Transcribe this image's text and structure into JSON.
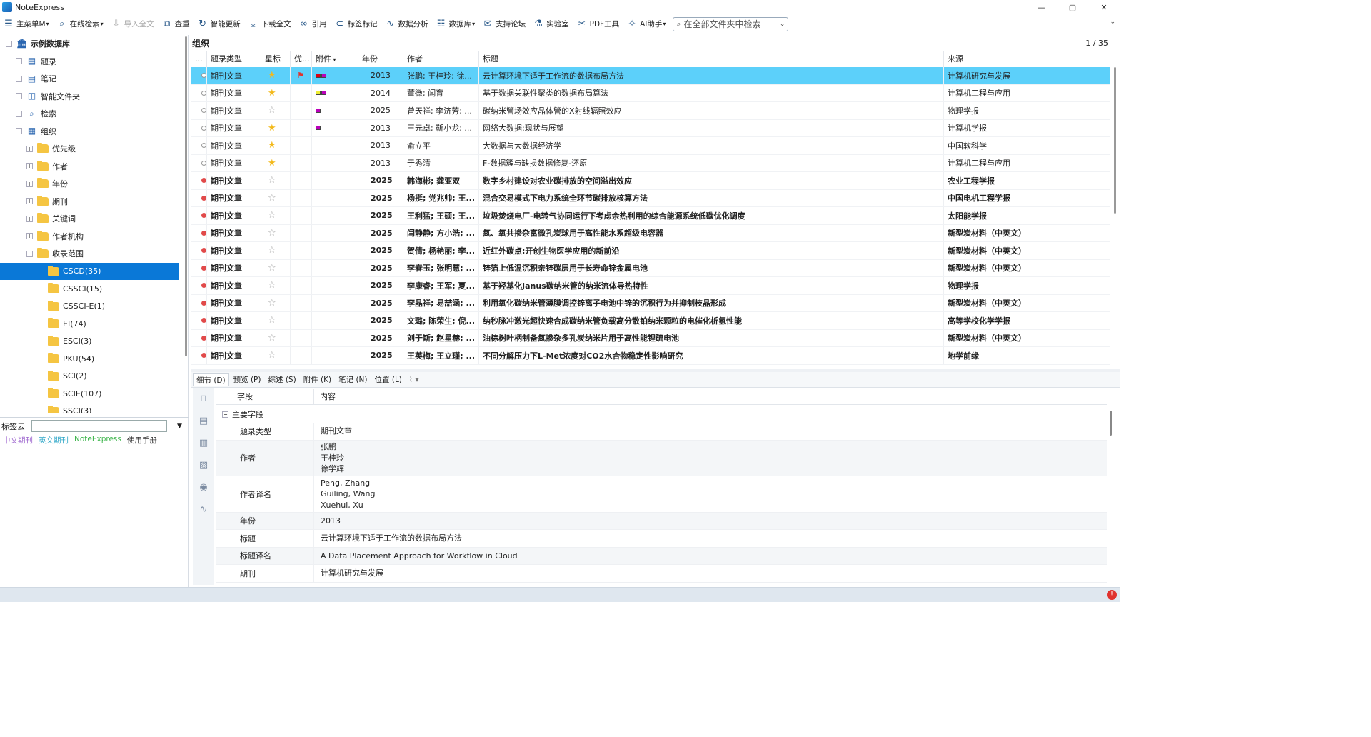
{
  "app": {
    "title": "NoteExpress",
    "min_label": "—",
    "max_label": "▢",
    "close_label": "✕"
  },
  "toolbar": [
    {
      "name": "main-menu",
      "label": "主菜单M",
      "icon": "menu-icon",
      "glyph": "☰",
      "dd": true,
      "enabled": true
    },
    {
      "name": "online-search",
      "label": "在线检索",
      "icon": "search-icon",
      "glyph": "⌕",
      "dd": true,
      "enabled": true
    },
    {
      "name": "import-fulltext",
      "label": "导入全文",
      "icon": "import-icon",
      "glyph": "⇩",
      "dd": false,
      "enabled": false
    },
    {
      "name": "dedupe",
      "label": "查重",
      "icon": "dedupe-icon",
      "glyph": "⧉",
      "dd": false,
      "enabled": true
    },
    {
      "name": "smart-update",
      "label": "智能更新",
      "icon": "refresh-icon",
      "glyph": "↻",
      "dd": false,
      "enabled": true
    },
    {
      "name": "download-fulltext",
      "label": "下载全文",
      "icon": "download-icon",
      "glyph": "⤓",
      "dd": false,
      "enabled": true
    },
    {
      "name": "cite",
      "label": "引用",
      "icon": "link-icon",
      "glyph": "∞",
      "dd": false,
      "enabled": true
    },
    {
      "name": "tag-mark",
      "label": "标签标记",
      "icon": "tag-icon",
      "glyph": "⊂",
      "dd": false,
      "enabled": true
    },
    {
      "name": "data-analysis",
      "label": "数据分析",
      "icon": "chart-icon",
      "glyph": "∿",
      "dd": false,
      "enabled": true
    },
    {
      "name": "database",
      "label": "数据库",
      "icon": "database-icon",
      "glyph": "☷",
      "dd": true,
      "enabled": true
    },
    {
      "name": "support-forum",
      "label": "支持论坛",
      "icon": "forum-icon",
      "glyph": "✉",
      "dd": false,
      "enabled": true
    },
    {
      "name": "lab",
      "label": "实验室",
      "icon": "flask-icon",
      "glyph": "⚗",
      "dd": false,
      "enabled": true
    },
    {
      "name": "pdf-tools",
      "label": "PDF工具",
      "icon": "tools-icon",
      "glyph": "✂",
      "dd": false,
      "enabled": true
    },
    {
      "name": "ai-assistant",
      "label": "AI助手",
      "icon": "ai-icon",
      "glyph": "✧",
      "dd": true,
      "enabled": true
    }
  ],
  "search": {
    "text": "在全部文件夹中检索",
    "more": "⌄"
  },
  "tree": {
    "root": "示例数据库",
    "items": [
      {
        "label": "题录",
        "level": 1,
        "icon": "records-icon",
        "glyph": "▤",
        "exp": "+"
      },
      {
        "label": "笔记",
        "level": 1,
        "icon": "notes-icon",
        "glyph": "▤",
        "exp": "+"
      },
      {
        "label": "智能文件夹",
        "level": 1,
        "icon": "smart-folder-icon",
        "glyph": "◫",
        "exp": "+"
      },
      {
        "label": "检索",
        "level": 1,
        "icon": "search-tree-icon",
        "glyph": "⌕",
        "exp": "+"
      },
      {
        "label": "组织",
        "level": 1,
        "icon": "organize-icon",
        "glyph": "▦",
        "exp": "−"
      },
      {
        "label": "优先级",
        "level": 2,
        "exp": "+"
      },
      {
        "label": "作者",
        "level": 2,
        "exp": "+"
      },
      {
        "label": "年份",
        "level": 2,
        "exp": "+"
      },
      {
        "label": "期刊",
        "level": 2,
        "exp": "+"
      },
      {
        "label": "关键词",
        "level": 2,
        "exp": "+"
      },
      {
        "label": "作者机构",
        "level": 2,
        "exp": "+"
      },
      {
        "label": "收录范围",
        "level": 2,
        "exp": "−"
      },
      {
        "label": "CSCD(35)",
        "level": 3,
        "sel": true
      },
      {
        "label": "CSSCI(15)",
        "level": 3
      },
      {
        "label": "CSSCI-E(1)",
        "level": 3
      },
      {
        "label": "EI(74)",
        "level": 3
      },
      {
        "label": "ESCI(3)",
        "level": 3
      },
      {
        "label": "PKU(54)",
        "level": 3
      },
      {
        "label": "SCI(2)",
        "level": 3
      },
      {
        "label": "SCIE(107)",
        "level": 3
      },
      {
        "label": "SSCI(3)",
        "level": 3
      }
    ]
  },
  "tagcloud": {
    "label": "标签云",
    "links": [
      {
        "text": "中文期刊",
        "color": "#a06ad0"
      },
      {
        "text": "英文期刊",
        "color": "#2fa7c8"
      },
      {
        "text": "NoteExpress",
        "color": "#3bb54a"
      },
      {
        "text": "使用手册",
        "color": "#333333"
      }
    ]
  },
  "grid": {
    "title": "组织",
    "page": "1 / 35",
    "columns": [
      "...",
      "题录类型",
      "星标",
      "优...",
      "附件",
      "年份",
      "作者",
      "标题",
      "来源"
    ],
    "rows": [
      {
        "read": "○",
        "type": "期刊文章",
        "star": true,
        "flag": true,
        "att": [
          "#d01",
          "#b0b"
        ],
        "year": "2013",
        "author": "张鹏; 王桂玲; 徐...",
        "title": "云计算环境下适于工作流的数据布局方法",
        "source": "计算机研究与发展",
        "sel": true,
        "unread": false
      },
      {
        "read": "○",
        "type": "期刊文章",
        "star": true,
        "flag": false,
        "att": [
          "#ee3",
          "#b0b"
        ],
        "year": "2014",
        "author": "董微; 闻育",
        "title": "基于数据关联性聚类的数据布局算法",
        "source": "计算机工程与应用",
        "unread": false
      },
      {
        "read": "○",
        "type": "期刊文章",
        "star": false,
        "flag": false,
        "att": [
          "#b0b"
        ],
        "year": "2025",
        "author": "曾天祥; 李济芳; ...",
        "title": "碳纳米管场效应晶体管的X射线辐照效应",
        "source": "物理学报",
        "unread": false
      },
      {
        "read": "○",
        "type": "期刊文章",
        "star": true,
        "flag": false,
        "att": [
          "#b0b"
        ],
        "year": "2013",
        "author": "王元卓; 靳小龙; ...",
        "title": "网络大数据:现状与展望",
        "source": "计算机学报",
        "unread": false
      },
      {
        "read": "○",
        "type": "期刊文章",
        "star": true,
        "flag": false,
        "att": [],
        "year": "2013",
        "author": "俞立平",
        "title": "大数据与大数据经济学",
        "source": "中国软科学",
        "unread": false
      },
      {
        "read": "○",
        "type": "期刊文章",
        "star": true,
        "flag": false,
        "att": [],
        "year": "2013",
        "author": "于秀清",
        "title": "F-数据簇与缺损数据修复-还原",
        "source": "计算机工程与应用",
        "unread": false
      },
      {
        "read": "●",
        "type": "期刊文章",
        "star": false,
        "flag": false,
        "att": [],
        "year": "2025",
        "author": "韩海彬; 龚亚双",
        "title": "数字乡村建设对农业碳排放的空间溢出效应",
        "source": "农业工程学报",
        "unread": true
      },
      {
        "read": "●",
        "type": "期刊文章",
        "star": false,
        "flag": false,
        "att": [],
        "year": "2025",
        "author": "杨挺; 党兆帅; 王...",
        "title": "混合交易模式下电力系统全环节碳排放核算方法",
        "source": "中国电机工程学报",
        "unread": true
      },
      {
        "read": "●",
        "type": "期刊文章",
        "star": false,
        "flag": false,
        "att": [],
        "year": "2025",
        "author": "王利猛; 王硕; 王...",
        "title": "垃圾焚烧电厂-电转气协同运行下考虑余热利用的综合能源系统低碳优化调度",
        "source": "太阳能学报",
        "unread": true
      },
      {
        "read": "●",
        "type": "期刊文章",
        "star": false,
        "flag": false,
        "att": [],
        "year": "2025",
        "author": "闫静静; 方小浩; ...",
        "title": "氮、氧共掺杂富微孔炭球用于高性能水系超级电容器",
        "source": "新型炭材料（中英文）",
        "unread": true
      },
      {
        "read": "●",
        "type": "期刊文章",
        "star": false,
        "flag": false,
        "att": [],
        "year": "2025",
        "author": "贺倩; 杨艳丽; 李...",
        "title": "近红外碳点:开创生物医学应用的新前沿",
        "source": "新型炭材料（中英文）",
        "unread": true
      },
      {
        "read": "●",
        "type": "期刊文章",
        "star": false,
        "flag": false,
        "att": [],
        "year": "2025",
        "author": "李春玉; 张明慧; ...",
        "title": "锌箔上低温沉积亲锌碳层用于长寿命锌金属电池",
        "source": "新型炭材料（中英文）",
        "unread": true
      },
      {
        "read": "●",
        "type": "期刊文章",
        "star": false,
        "flag": false,
        "att": [],
        "year": "2025",
        "author": "李康睿; 王军; 夏...",
        "title": "基于羟基化Janus碳纳米管的纳米流体导热特性",
        "source": "物理学报",
        "unread": true
      },
      {
        "read": "●",
        "type": "期刊文章",
        "star": false,
        "flag": false,
        "att": [],
        "year": "2025",
        "author": "李晶祥; 易喆涵; ...",
        "title": "利用氧化碳纳米管薄膜调控锌离子电池中锌的沉积行为并抑制枝晶形成",
        "source": "新型炭材料（中英文）",
        "unread": true
      },
      {
        "read": "●",
        "type": "期刊文章",
        "star": false,
        "flag": false,
        "att": [],
        "year": "2025",
        "author": "文璐; 陈荣生; 倪...",
        "title": "纳秒脉冲激光超快速合成碳纳米管负载高分散铂纳米颗粒的电催化析氢性能",
        "source": "高等学校化学学报",
        "unread": true
      },
      {
        "read": "●",
        "type": "期刊文章",
        "star": false,
        "flag": false,
        "att": [],
        "year": "2025",
        "author": "刘于斯; 赵星赫; ...",
        "title": "油棕树叶柄制备氮掺杂多孔炭纳米片用于高性能锂硫电池",
        "source": "新型炭材料（中英文）",
        "unread": true
      },
      {
        "read": "●",
        "type": "期刊文章",
        "star": false,
        "flag": false,
        "att": [],
        "year": "2025",
        "author": "王英梅; 王立瑾; ...",
        "title": "不同分解压力下L-Met浓度对CO2水合物稳定性影响研究",
        "source": "地学前缘",
        "unread": true
      }
    ]
  },
  "tabs": [
    {
      "label": "细节 (D)",
      "act": true
    },
    {
      "label": "预览 (P)"
    },
    {
      "label": "综述 (S)"
    },
    {
      "label": "附件 (K)"
    },
    {
      "label": "笔记 (N)"
    },
    {
      "label": "位置 (L)"
    }
  ],
  "detail": {
    "head": [
      "字段",
      "内容"
    ],
    "section": "主要字段",
    "fields": [
      {
        "key": "题录类型",
        "values": [
          "期刊文章"
        ]
      },
      {
        "key": "作者",
        "values": [
          "张鹏",
          "王桂玲",
          "徐学辉"
        ]
      },
      {
        "key": "作者译名",
        "values": [
          "Peng, Zhang",
          "Guiling, Wang",
          "Xuehui, Xu"
        ]
      },
      {
        "key": "年份",
        "values": [
          "2013"
        ]
      },
      {
        "key": "标题",
        "values": [
          "云计算环境下适于工作流的数据布局方法"
        ]
      },
      {
        "key": "标题译名",
        "values": [
          "A Data Placement Approach for Workflow in Cloud"
        ]
      },
      {
        "key": "期刊",
        "values": [
          "计算机研究与发展"
        ]
      }
    ]
  }
}
